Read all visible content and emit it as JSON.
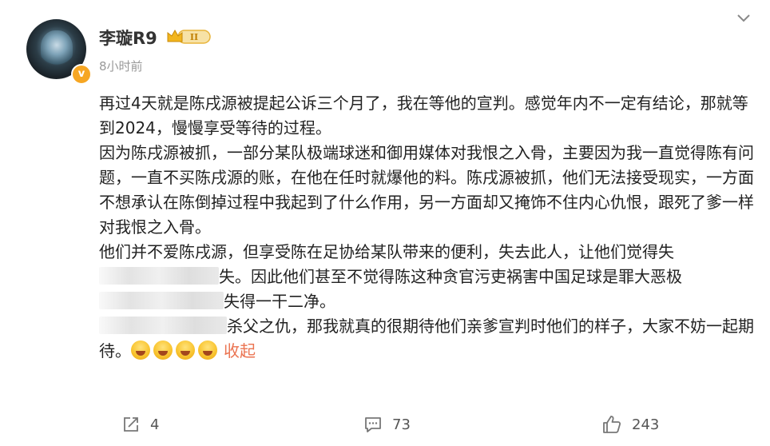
{
  "user": {
    "name": "李璇R9",
    "time": "8小时前",
    "verified_mark": "v",
    "avatar_icon": "avatar-flower-icon",
    "rank_icon": "crown-rank-badge-icon"
  },
  "post": {
    "paragraphs": [
      {
        "text": "再过4天就是陈戌源被提起公诉三个月了，我在等他的宣判。感觉年内不一定有结论，那就等到2024，慢慢享受等待的过程。"
      },
      {
        "text": "因为陈戌源被抓，一部分某队极端球迷和御用媒体对我恨之入骨，主要因为我一直觉得陈有问题，一直不买陈戌源的账，在他在任时就爆他的料。陈戌源被抓，他们无法接受现实，一方面不想承认在陈倒掉过程中我起到了什么作用，另一方面却又掩饰不住内心仇恨，跟死了爹一样对我恨之入骨。"
      },
      {
        "text": "他们并不爱陈戌源，但享受陈在足协给某队带来的便利，失去此人，让他们觉得失"
      },
      {
        "text": "失。因此他们甚至不觉得陈这种贪官污吏祸害中国足球是罪大恶极"
      },
      {
        "text": "失得一干二净。"
      },
      {
        "text": "杀父之仇，那我就真的很期待他们亲爹宣判时他们的样子，大家不妨一起期待。"
      }
    ],
    "emoji_name": "laughing-tears-emoji",
    "emoji_count": 4,
    "collapse_label": "收起"
  },
  "actions": {
    "share_count": "4",
    "comment_count": "73",
    "like_count": "243"
  },
  "colors": {
    "link": "#eb7350",
    "verified_badge": "#f6a623",
    "rank_badge": "#e8b43a"
  }
}
